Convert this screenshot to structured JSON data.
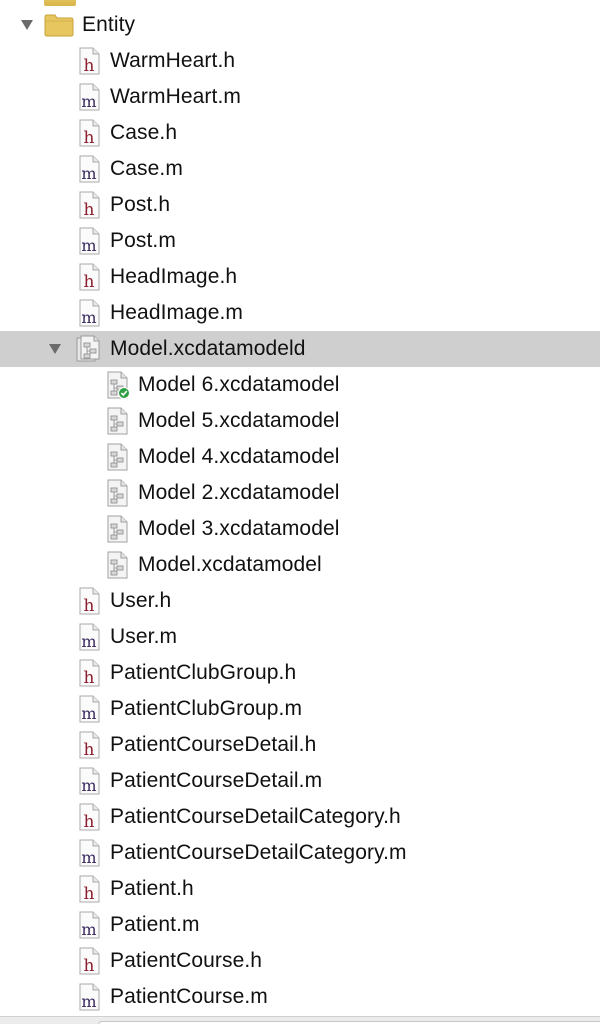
{
  "navigator": {
    "entity_group": {
      "label": "Entity",
      "icon": "folder-icon",
      "expanded": true
    },
    "files_before_model": [
      {
        "name": "WarmHeart.h",
        "type": "h"
      },
      {
        "name": "WarmHeart.m",
        "type": "m"
      },
      {
        "name": "Case.h",
        "type": "h"
      },
      {
        "name": "Case.m",
        "type": "m"
      },
      {
        "name": "Post.h",
        "type": "h"
      },
      {
        "name": "Post.m",
        "type": "m"
      },
      {
        "name": "HeadImage.h",
        "type": "h"
      },
      {
        "name": "HeadImage.m",
        "type": "m"
      }
    ],
    "model_bundle": {
      "name": "Model.xcdatamodeld",
      "icon": "data-model-bundle-icon",
      "expanded": true,
      "selected": true
    },
    "model_versions": [
      {
        "name": "Model 6.xcdatamodel",
        "current": true
      },
      {
        "name": "Model 5.xcdatamodel",
        "current": false
      },
      {
        "name": "Model 4.xcdatamodel",
        "current": false
      },
      {
        "name": "Model 2.xcdatamodel",
        "current": false
      },
      {
        "name": "Model 3.xcdatamodel",
        "current": false
      },
      {
        "name": "Model.xcdatamodel",
        "current": false
      }
    ],
    "files_after_model": [
      {
        "name": "User.h",
        "type": "h"
      },
      {
        "name": "User.m",
        "type": "m"
      },
      {
        "name": "PatientClubGroup.h",
        "type": "h"
      },
      {
        "name": "PatientClubGroup.m",
        "type": "m"
      },
      {
        "name": "PatientCourseDetail.h",
        "type": "h"
      },
      {
        "name": "PatientCourseDetail.m",
        "type": "m"
      },
      {
        "name": "PatientCourseDetailCategory.h",
        "type": "h"
      },
      {
        "name": "PatientCourseDetailCategory.m",
        "type": "m"
      },
      {
        "name": "Patient.h",
        "type": "h"
      },
      {
        "name": "Patient.m",
        "type": "m"
      },
      {
        "name": "PatientCourse.h",
        "type": "h"
      },
      {
        "name": "PatientCourse.m",
        "type": "m"
      }
    ]
  },
  "colors": {
    "selection": "#cfcfcf",
    "header_letter": "#8b1d2c",
    "impl_letter": "#3a2a5c",
    "folder": "#e7c65f",
    "current_badge": "#2ea043"
  }
}
